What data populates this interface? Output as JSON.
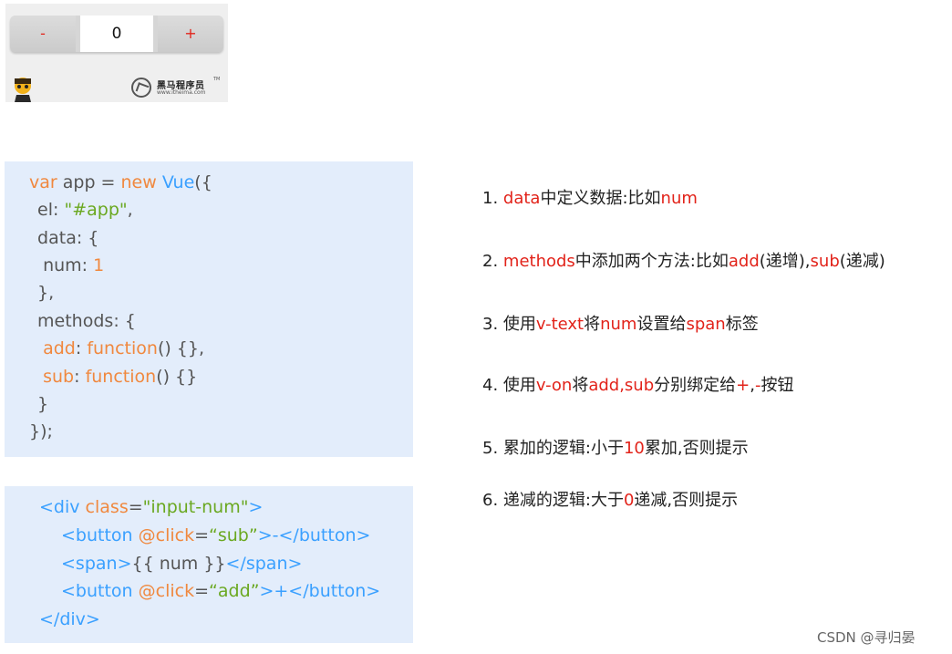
{
  "widget": {
    "minus_label": "-",
    "value": "0",
    "plus_label": "+",
    "logo_name": "黑马程序员",
    "logo_url": "www.itheima.com",
    "logo_tm": "TM"
  },
  "code_js": {
    "l1a": "var",
    "l1b": " app = ",
    "l1c": "new",
    "l1d": " ",
    "l1e": "Vue",
    "l1f": "({",
    "l2a": " el: ",
    "l2b": "\"#app\"",
    "l2c": ",",
    "l3": " data: {",
    "l4a": "  num: ",
    "l4b": "1",
    "l5": " },",
    "l6": " methods: {",
    "l7a": "  ",
    "l7b": "add",
    "l7c": ": ",
    "l7d": "function",
    "l7e": "() {},",
    "l8a": "  ",
    "l8b": "sub",
    "l8c": ": ",
    "l8d": "function",
    "l8e": "() {}",
    "l9": " }",
    "l10": "});"
  },
  "code_html": {
    "l1a": "<div ",
    "l1b": "class",
    "l1c": "=",
    "l1d": "\"input-num\"",
    "l1e": ">",
    "l2a": "<button ",
    "l2b": "@click",
    "l2c": "=",
    "l2d": "“sub”",
    "l2e": ">-</button>",
    "l3a": "<span>",
    "l3b": "{{ num }}",
    "l3c": "</span>",
    "l4a": "<button ",
    "l4b": "@click",
    "l4c": "=",
    "l4d": "“add”",
    "l4e": ">+</button>",
    "l5": "</div>"
  },
  "steps": [
    {
      "p1": "1. ",
      "r1": "data",
      "p2": "中定义数据:比如",
      "r2": "num",
      "p3": "",
      "r3": "",
      "p4": "",
      "r4": "",
      "p5": ""
    },
    {
      "p1": "2. ",
      "r1": "methods",
      "p2": "中添加两个方法:比如",
      "r2": "add",
      "p3": "(递增),",
      "r3": "sub",
      "p4": "(递减)",
      "r4": "",
      "p5": ""
    },
    {
      "p1": "3. 使用",
      "r1": "v-text",
      "p2": "将",
      "r2": "num",
      "p3": "设置给",
      "r3": "span",
      "p4": "标签",
      "r4": "",
      "p5": ""
    },
    {
      "p1": "4. 使用",
      "r1": "v-on",
      "p2": "将",
      "r2": "add,sub",
      "p3": "分别绑定给",
      "r3": "+",
      "p4": ",",
      "r4": "-",
      "p5": "按钮"
    },
    {
      "p1": "5. 累加的逻辑:小于",
      "r1": "10",
      "p2": "累加,否则提示",
      "r2": "",
      "p3": "",
      "r3": "",
      "p4": "",
      "r4": "",
      "p5": ""
    },
    {
      "p1": "6. 递减的逻辑:大于",
      "r1": "0",
      "p2": "递减,否则提示",
      "r2": "",
      "p3": "",
      "r3": "",
      "p4": "",
      "r4": "",
      "p5": ""
    }
  ],
  "credit": "CSDN @寻归晏"
}
